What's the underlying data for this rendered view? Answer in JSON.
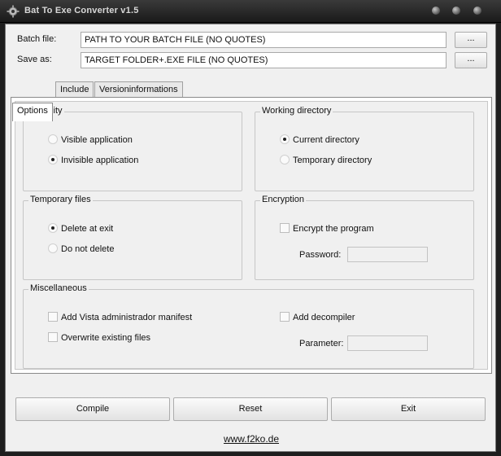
{
  "window": {
    "title": "Bat To Exe Converter v1.5",
    "app_icon": "gear-icon"
  },
  "fields": {
    "batch_label": "Batch file:",
    "batch_value": "PATH TO YOUR BATCH FILE (NO QUOTES)",
    "save_label": "Save as:",
    "save_value": "TARGET FOLDER+.EXE FILE (NO QUOTES)",
    "browse_label": "..."
  },
  "tabs": [
    "Options",
    "Include",
    "Versioninformations"
  ],
  "options": {
    "visibility": {
      "title": "Visibility",
      "items": [
        "Visible application",
        "Invisible application"
      ],
      "selected": 1
    },
    "working_dir": {
      "title": "Working directory",
      "items": [
        "Current directory",
        "Temporary directory"
      ],
      "selected": 0
    },
    "temp_files": {
      "title": "Temporary files",
      "items": [
        "Delete at exit",
        "Do not delete"
      ],
      "selected": 0
    },
    "encryption": {
      "title": "Encryption",
      "encrypt_label": "Encrypt the program",
      "password_label": "Password:"
    },
    "misc": {
      "title": "Miscellaneous",
      "vista_label": "Add Vista administrador manifest",
      "overwrite_label": "Overwrite existing files",
      "decompiler_label": "Add decompiler",
      "parameter_label": "Parameter:"
    }
  },
  "actions": {
    "compile": "Compile",
    "reset": "Reset",
    "exit": "Exit"
  },
  "footer": {
    "link": "www.f2ko.de"
  }
}
